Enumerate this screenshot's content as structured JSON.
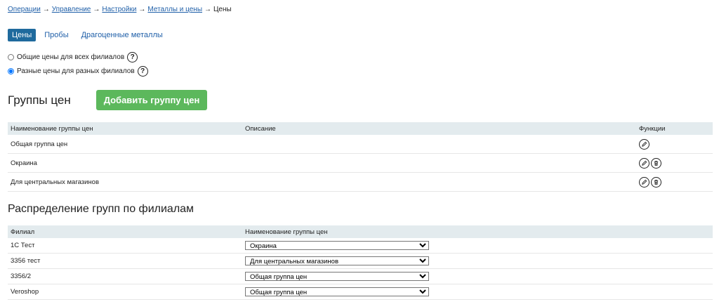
{
  "breadcrumb": {
    "items": [
      "Операции",
      "Управление",
      "Настройки",
      "Металлы и цены"
    ],
    "separator": "→",
    "current": "Цены"
  },
  "tabs": [
    {
      "label": "Цены",
      "active": true
    },
    {
      "label": "Пробы",
      "active": false
    },
    {
      "label": "Драгоценные металлы",
      "active": false
    }
  ],
  "pricing_mode": {
    "options": [
      {
        "label": "Общие цены для всех филиалов",
        "checked": false
      },
      {
        "label": "Разные цены для разных филиалов",
        "checked": true
      }
    ],
    "help_symbol": "?"
  },
  "price_groups": {
    "title": "Группы цен",
    "add_button": "Добавить группу цен",
    "columns": [
      "Наименование группы цен",
      "Описание",
      "Функции"
    ],
    "rows": [
      {
        "name": "Общая группа цен",
        "description": "",
        "can_delete": false
      },
      {
        "name": "Окраина",
        "description": "",
        "can_delete": true
      },
      {
        "name": "Для центральных магазинов",
        "description": "",
        "can_delete": true
      }
    ]
  },
  "distribution": {
    "title": "Распределение групп по филиалам",
    "columns": [
      "Филиал",
      "Наименование группы цен"
    ],
    "rows": [
      {
        "branch": "1С Тест",
        "group": "Окраина"
      },
      {
        "branch": "3356 тест",
        "group": "Для центральных магазинов"
      },
      {
        "branch": "3356/2",
        "group": "Общая группа цен"
      },
      {
        "branch": "Veroshop",
        "group": "Общая группа цен"
      }
    ]
  }
}
